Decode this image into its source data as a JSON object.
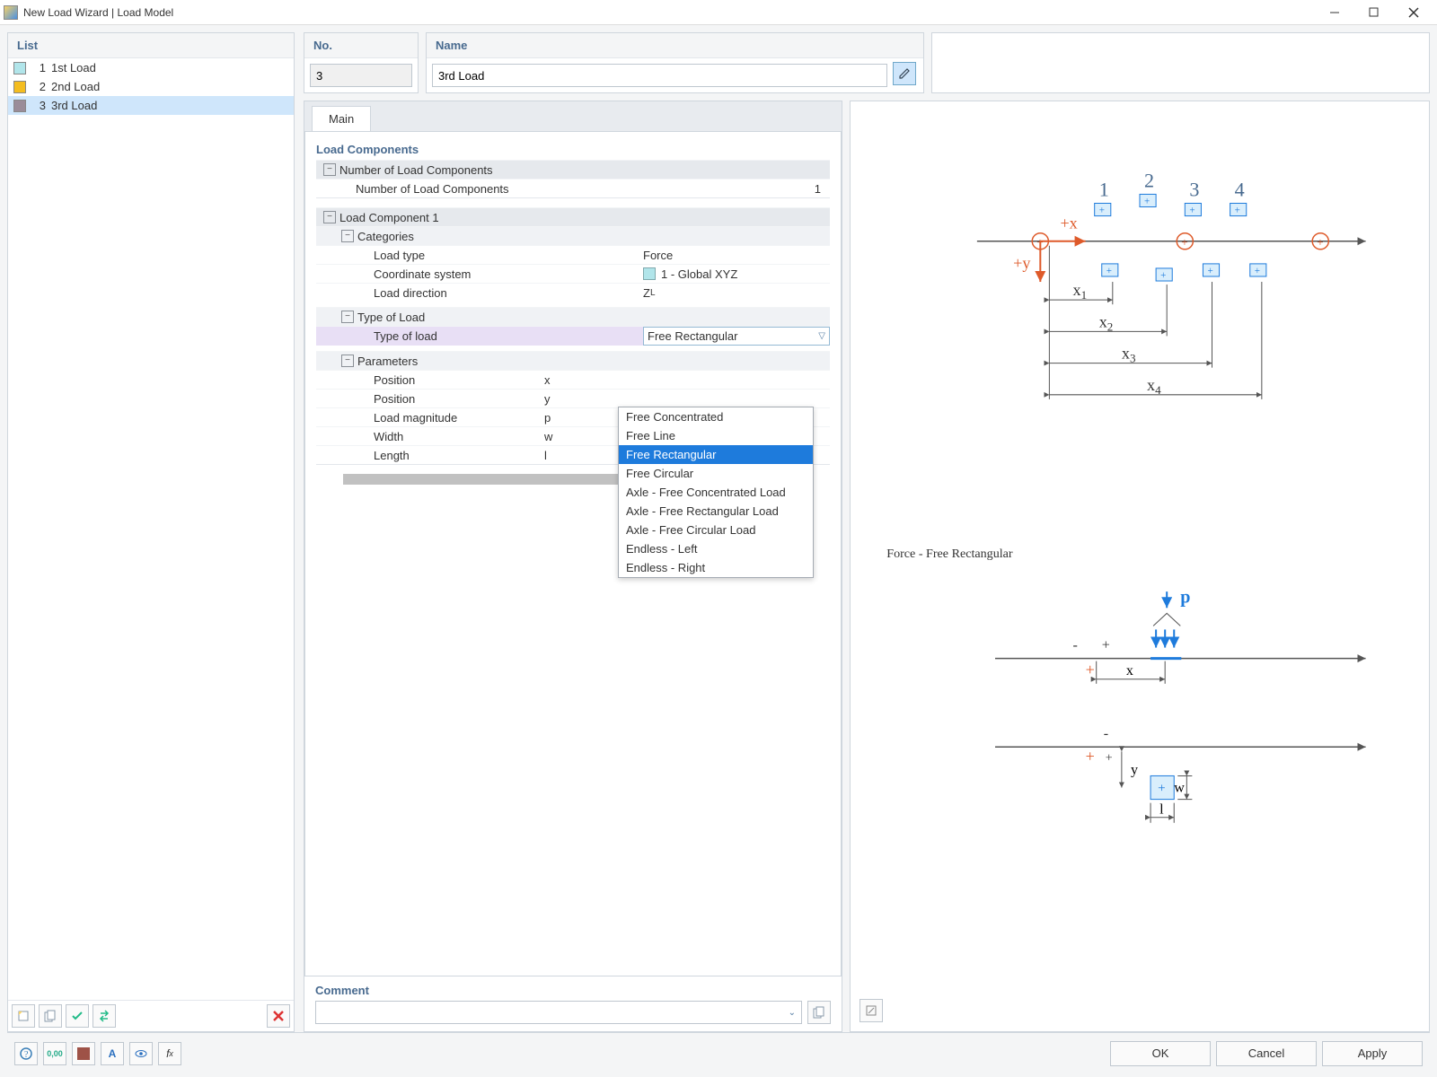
{
  "window": {
    "title": "New Load Wizard | Load Model"
  },
  "list": {
    "header": "List",
    "items": [
      {
        "n": "1",
        "label": "1st Load",
        "color": "#b1e5ea"
      },
      {
        "n": "2",
        "label": "2nd Load",
        "color": "#f4bd20"
      },
      {
        "n": "3",
        "label": "3rd Load",
        "color": "#9a8c99"
      }
    ]
  },
  "no": {
    "header": "No.",
    "value": "3"
  },
  "name": {
    "header": "Name",
    "value": "3rd Load"
  },
  "tabs": {
    "main": "Main"
  },
  "props": {
    "section1": "Load Components",
    "num_label": "Number of Load Components",
    "num_label2": "Number of Load Components",
    "num_value": "1",
    "section2": "Load Component 1",
    "categories": "Categories",
    "cat_loadtype_l": "Load type",
    "cat_loadtype_v": "Force",
    "cat_coord_l": "Coordinate system",
    "cat_coord_v": "1 - Global XYZ",
    "cat_dir_l": "Load direction",
    "cat_dir_v": "Z",
    "cat_dir_sub": "L",
    "type_header": "Type of Load",
    "type_label": "Type of load",
    "type_value": "Free Rectangular",
    "params": "Parameters",
    "p_pos": "Position",
    "p_mag": "Load magnitude",
    "p_width": "Width",
    "p_length": "Length",
    "sym_x": "x",
    "sym_y": "y",
    "sym_p": "p",
    "sym_w": "w",
    "sym_l": "l"
  },
  "dropdown": [
    "Free Concentrated",
    "Free Line",
    "Free Rectangular",
    "Free Circular",
    "Axle - Free Concentrated Load",
    "Axle - Free Rectangular Load",
    "Axle - Free Circular Load",
    "Endless - Left",
    "Endless - Right"
  ],
  "diagram_caption": "Force - Free Rectangular",
  "comment": {
    "header": "Comment"
  },
  "buttons": {
    "ok": "OK",
    "cancel": "Cancel",
    "apply": "Apply"
  }
}
